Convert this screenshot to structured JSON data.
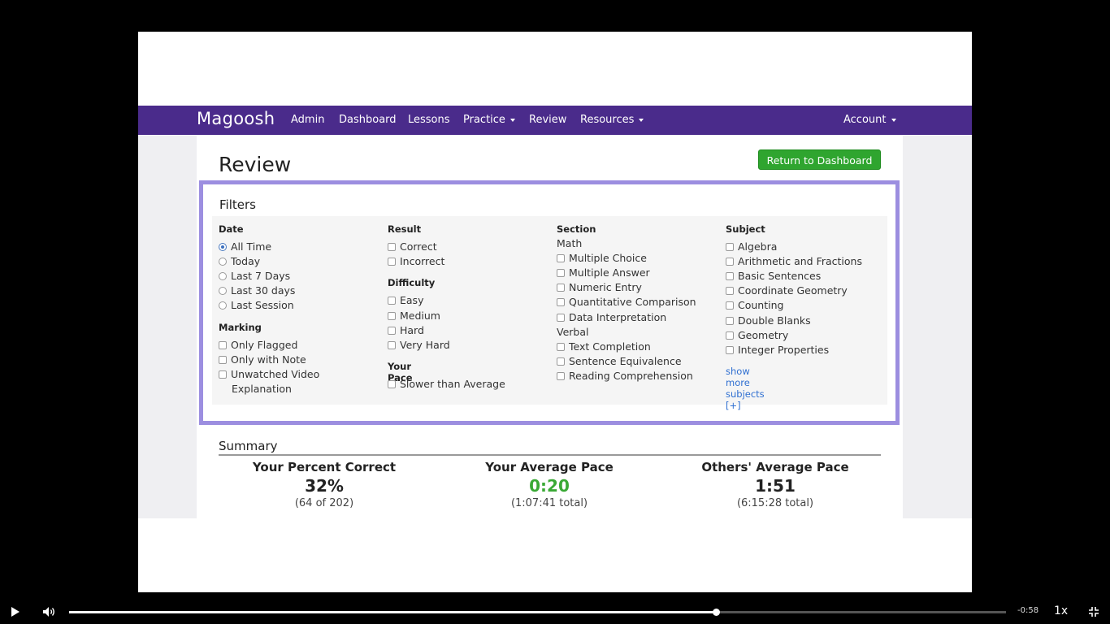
{
  "app": {
    "logo": "Magoosh",
    "nav": [
      "Admin",
      "Dashboard",
      "Lessons",
      "Practice",
      "Review",
      "Resources"
    ],
    "account": "Account"
  },
  "page": {
    "title": "Review",
    "return_button": "Return to Dashboard"
  },
  "filters": {
    "title": "Filters",
    "date": {
      "label": "Date",
      "options": [
        "All Time",
        "Today",
        "Last 7 Days",
        "Last 30 days",
        "Last Session"
      ],
      "selected": "All Time"
    },
    "marking": {
      "label": "Marking",
      "options": [
        "Only Flagged",
        "Only with Note",
        "Unwatched Video",
        "Explanation"
      ]
    },
    "result": {
      "label": "Result",
      "options": [
        "Correct",
        "Incorrect"
      ]
    },
    "difficulty": {
      "label": "Difficulty",
      "options": [
        "Easy",
        "Medium",
        "Hard",
        "Very Hard"
      ]
    },
    "pace": {
      "label": "Your Pace",
      "options": [
        "Slower than Average"
      ]
    },
    "section": {
      "label": "Section",
      "math_label": "Math",
      "math": [
        "Multiple Choice",
        "Multiple Answer",
        "Numeric Entry",
        "Quantitative Comparison",
        "Data Interpretation"
      ],
      "verbal_label": "Verbal",
      "verbal": [
        "Text Completion",
        "Sentence Equivalence",
        "Reading Comprehension"
      ]
    },
    "subject": {
      "label": "Subject",
      "options": [
        "Algebra",
        "Arithmetic and Fractions",
        "Basic Sentences",
        "Coordinate Geometry",
        "Counting",
        "Double Blanks",
        "Geometry",
        "Integer Properties"
      ],
      "more": "show more subjects [+]"
    }
  },
  "summary": {
    "title": "Summary",
    "stats": [
      {
        "label": "Your Percent Correct",
        "value": "32%",
        "sub": "(64 of 202)"
      },
      {
        "label": "Your Average Pace",
        "value": "0:20",
        "sub": "(1:07:41 total)"
      },
      {
        "label": "Others' Average Pace",
        "value": "1:51",
        "sub": "(6:15:28 total)"
      }
    ]
  },
  "player": {
    "time_remaining": "-0:58",
    "speed": "1x",
    "progress": 0.69
  }
}
